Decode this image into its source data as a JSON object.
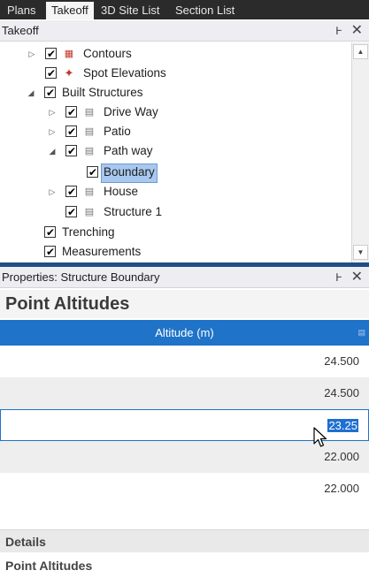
{
  "tabs": [
    {
      "label": "Plans",
      "active": false
    },
    {
      "label": "Takeoff",
      "active": true
    },
    {
      "label": "3D Site List",
      "active": false
    },
    {
      "label": "Section List",
      "active": false
    }
  ],
  "takeoff_panel": {
    "title": "Takeoff",
    "pin_glyph": "Ͱ",
    "close_glyph": "✕"
  },
  "tree": {
    "items": [
      {
        "label": "Contours",
        "expander": "collapsed",
        "checked": true,
        "icon": "contours-icon"
      },
      {
        "label": "Spot Elevations",
        "expander": "none",
        "checked": true,
        "icon": "spot-elevation-icon"
      },
      {
        "label": "Built Structures",
        "expander": "expanded",
        "checked": true,
        "icon": "none"
      },
      {
        "label": "Drive Way",
        "expander": "collapsed",
        "checked": true,
        "icon": "structure-icon"
      },
      {
        "label": "Patio",
        "expander": "collapsed",
        "checked": true,
        "icon": "structure-icon"
      },
      {
        "label": "Path way",
        "expander": "expanded",
        "checked": true,
        "icon": "structure-icon"
      },
      {
        "label": "Boundary",
        "expander": "none",
        "checked": true,
        "icon": "none",
        "selected": true
      },
      {
        "label": "House",
        "expander": "collapsed",
        "checked": true,
        "icon": "structure-icon"
      },
      {
        "label": "Structure 1",
        "expander": "none",
        "checked": true,
        "icon": "structure-icon"
      },
      {
        "label": "Trenching",
        "expander": "none",
        "checked": true,
        "icon": "none"
      },
      {
        "label": "Measurements",
        "expander": "none",
        "checked": true,
        "icon": "none"
      }
    ]
  },
  "properties_panel": {
    "title": "Properties: Structure Boundary",
    "heading": "Point Altitudes",
    "column_header": "Altitude (m)",
    "rows": [
      "24.500",
      "24.500",
      "23.25",
      "22.000",
      "22.000"
    ],
    "editing_row_value": "23.25",
    "details_label": "Details",
    "description": "Point Altitudes"
  },
  "colors": {
    "accent": "#1f73c8",
    "selection": "#a9c8ef",
    "splitter": "#1f4e86"
  }
}
